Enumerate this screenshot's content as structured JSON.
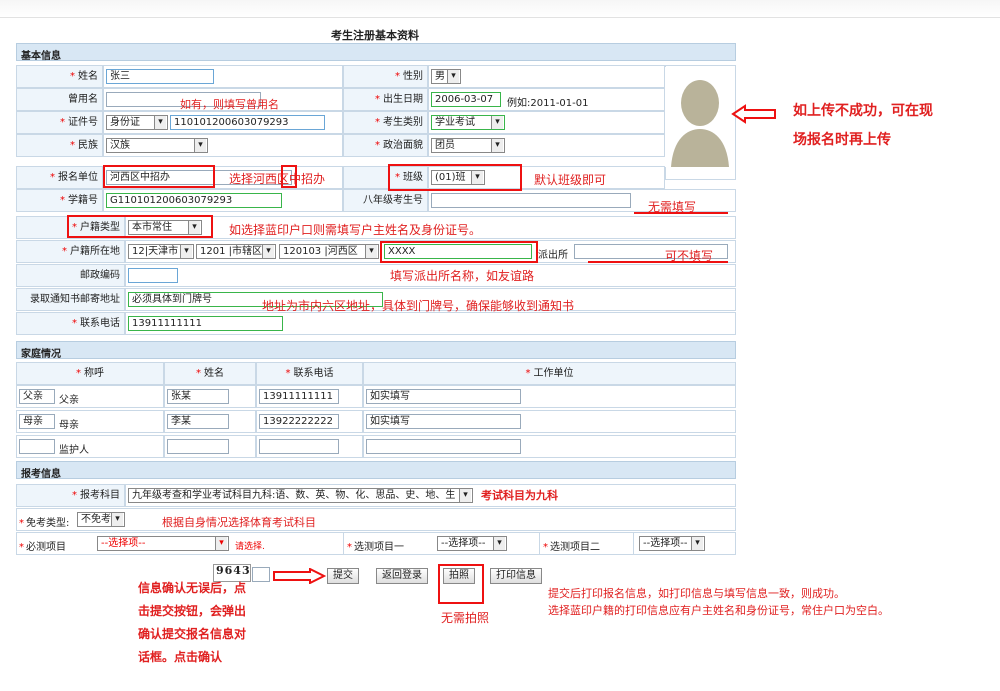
{
  "title": "考生注册基本资料",
  "sections": {
    "basic": "基本信息",
    "family": "家庭情况",
    "exam": "报考信息"
  },
  "basic": {
    "name_label": "姓名",
    "name_value": "张三",
    "gender_label": "性别",
    "gender_value": "男",
    "former_name_label": "曾用名",
    "dob_label": "出生日期",
    "dob_value": "2006-03-07",
    "dob_hint": "例如:2011-01-01",
    "id_label": "证件号",
    "id_type": "身份证",
    "id_value": "110101200603079293",
    "category_label": "考生类别",
    "category_value": "学业考试",
    "ethnicity_label": "民族",
    "ethnicity_value": "汉族",
    "political_label": "政治面貌",
    "political_value": "团员",
    "unit_label": "报名单位",
    "unit_value": "河西区中招办",
    "class_label": "班级",
    "class_value": "(01)班",
    "student_no_label": "学籍号",
    "student_no_value": "G110101200603079293",
    "grade8_label": "八年级考生号",
    "hukou_type_label": "户籍类型",
    "hukou_type_value": "本市常住",
    "hukou_loc_label": "户籍所在地",
    "hukou_city": "12|天津市",
    "hukou_district": "1201 |市辖区",
    "hukou_area": "120103 |河西区",
    "hukou_detail": "XXXX",
    "police_label": "派出所",
    "postcode_label": "邮政编码",
    "address_label": "录取通知书邮寄地址",
    "address_value": "必须具体到门牌号",
    "phone_label": "联系电话",
    "phone_value": "13911111111"
  },
  "family": {
    "headers": [
      "称呼",
      "姓名",
      "联系电话",
      "工作单位"
    ],
    "rows": [
      {
        "input": "父亲",
        "relation": "父亲",
        "name": "张某",
        "phone": "13911111111",
        "work": "如实填写"
      },
      {
        "input": "母亲",
        "relation": "母亲",
        "name": "李某",
        "phone": "13922222222",
        "work": "如实填写"
      },
      {
        "input": "",
        "relation": "监护人",
        "name": "",
        "phone": "",
        "work": ""
      }
    ]
  },
  "exam": {
    "subjects_label": "报考科目",
    "subjects_value": "九年级考查和学业考试科目九科:语、数、英、物、化、思品、史、地、生",
    "exempt_label": "免考类型:",
    "exempt_value": "不免考",
    "required_label": "必测项目",
    "required_value": "--选择项--",
    "required_hint": "请选择.",
    "opt1_label": "选测项目一",
    "opt1_value": "--选择项--",
    "opt2_label": "选测项目二",
    "opt2_value": "--选择项--"
  },
  "captcha": "9643",
  "buttons": {
    "submit": "提交",
    "back": "返回登录",
    "photo": "拍照",
    "print": "打印信息"
  },
  "annotations": {
    "former_name": "如有，则填写曾用名",
    "photo_note_1": "如上传不成功，可在现",
    "photo_note_2": "场报名时再上传",
    "unit": "选择河西区中招办",
    "class": "默认班级即可",
    "grade8": "无需填写",
    "hukou": "如选择蓝印户口则需填写户主姓名及身份证号。",
    "police": "可不填写",
    "police_name": "填写派出所名称，如友谊路",
    "address": "地址为市内六区地址，具体到门牌号，确保能够收到通知书",
    "subjects": "考试科目为九科",
    "exempt": "根据自身情况选择体育考试科目",
    "submit_1": "信息确认无误后，点",
    "submit_2": "击提交按钮，会弹出",
    "submit_3": "确认提交报名信息对",
    "submit_4": "话框。点击确认",
    "photo_btn": "无需拍照",
    "print_1": "提交后打印报名信息，如打印信息与填写信息一致，则成功。",
    "print_2": "选择蓝印户籍的打印信息应有户主姓名和身份证号，常住户口为空白。"
  },
  "colors": {
    "annotation": "#e02020",
    "header_bg": "#d8e7f4",
    "label_bg": "#eef5fb"
  }
}
